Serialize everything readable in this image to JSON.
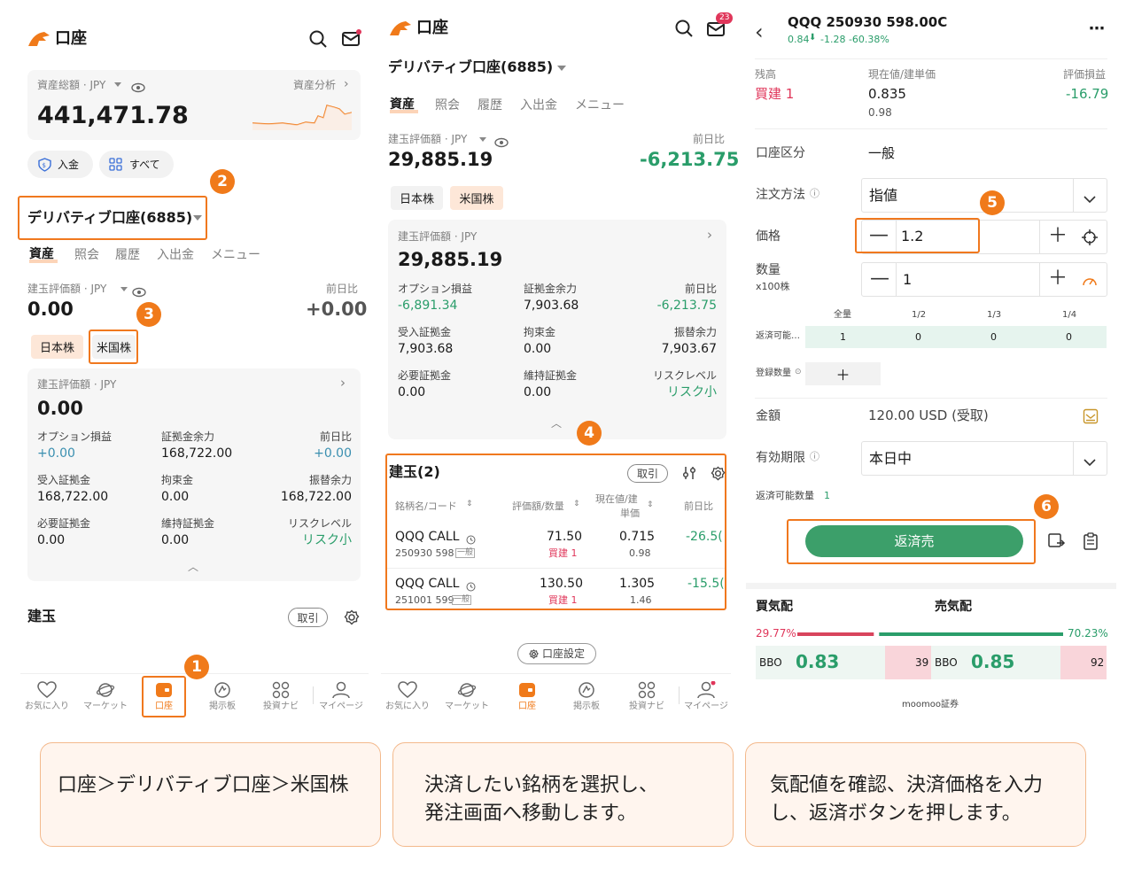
{
  "p1": {
    "title": "口座",
    "asset_label": "資産総額 · JPY",
    "asset_link": "資産分析",
    "asset_value": "441,471.78",
    "deposit": "入金",
    "all": "すべて",
    "account_name": "デリバティブ口座(6885)",
    "tabs": [
      "資産",
      "照会",
      "履歴",
      "入出金",
      "メニュー"
    ],
    "pos_label": "建玉評価額 · JPY",
    "prev_label": "前日比",
    "pos_value": "0.00",
    "prev_value": "+0.00",
    "chip_jp": "日本株",
    "chip_us": "米国株",
    "card_label": "建玉評価額 · JPY",
    "card_value": "0.00",
    "grid": [
      {
        "l": "オプション損益",
        "v": "+0.00"
      },
      {
        "l": "証拠金余力",
        "v": "168,722.00"
      },
      {
        "l": "前日比",
        "v": "+0.00"
      },
      {
        "l": "受入証拠金",
        "v": "168,722.00"
      },
      {
        "l": "拘束金",
        "v": "0.00"
      },
      {
        "l": "振替余力",
        "v": "168,722.00"
      },
      {
        "l": "必要証拠金",
        "v": "0.00"
      },
      {
        "l": "維持証拠金",
        "v": "0.00"
      },
      {
        "l": "リスクレベル",
        "v": "リスク小"
      }
    ],
    "section": "建玉",
    "pill": "取引",
    "nav": [
      "お気に入り",
      "マーケット",
      "口座",
      "掲示板",
      "投資ナビ",
      "マイページ"
    ]
  },
  "p2": {
    "title": "口座",
    "mail_count": "23",
    "account_name": "デリバティブ口座(6885)",
    "tabs": [
      "資産",
      "照会",
      "履歴",
      "入出金",
      "メニュー"
    ],
    "pos_label": "建玉評価額 · JPY",
    "prev_label": "前日比",
    "pos_value": "29,885.19",
    "prev_value": "-6,213.75",
    "chip_jp": "日本株",
    "chip_us": "米国株",
    "card_label": "建玉評価額 · JPY",
    "card_value": "29,885.19",
    "grid": [
      {
        "l": "オプション損益",
        "v": "-6,891.34"
      },
      {
        "l": "証拠金余力",
        "v": "7,903.68"
      },
      {
        "l": "前日比",
        "v": "-6,213.75"
      },
      {
        "l": "受入証拠金",
        "v": "7,903.68"
      },
      {
        "l": "拘束金",
        "v": "0.00"
      },
      {
        "l": "振替余力",
        "v": "7,903.67"
      },
      {
        "l": "必要証拠金",
        "v": "0.00"
      },
      {
        "l": "維持証拠金",
        "v": "0.00"
      },
      {
        "l": "リスクレベル",
        "v": "リスク小"
      }
    ],
    "section": "建玉(2)",
    "pill": "取引",
    "cols": [
      "銘柄名/コード",
      "評価額/数量",
      "現在値/建",
      "単価",
      "前日比"
    ],
    "rows": [
      {
        "name": "QQQ CALL",
        "code": "250930 598",
        "tag": "一般",
        "val": "71.50",
        "qty": "買建 1",
        "cur": "0.715",
        "unit": "0.98",
        "chg": "-26.5("
      },
      {
        "name": "QQQ CALL",
        "code": "251001 599",
        "tag": "一般",
        "val": "130.50",
        "qty": "買建 1",
        "cur": "1.305",
        "unit": "1.46",
        "chg": "-15.5("
      }
    ],
    "settings": "口座設定",
    "nav": [
      "お気に入り",
      "マーケット",
      "口座",
      "掲示板",
      "投資ナビ",
      "マイページ"
    ]
  },
  "p3": {
    "title": "QQQ 250930 598.00C",
    "subtitle": "0.84",
    "sub_change": "-1.28 -60.38%",
    "hdr": [
      "残高",
      "現在値/建単価",
      "評価損益"
    ],
    "bal": "買建 1",
    "cur": "0.835",
    "unit": "0.98",
    "pl": "-16.79",
    "acct_l": "口座区分",
    "acct_v": "一般",
    "method_l": "注文方法",
    "method_v": "指値",
    "price_l": "価格",
    "price_v": "1.2",
    "qty_l": "数量",
    "qty_sub": "x100株",
    "qty_v": "1",
    "ratios": [
      "全量",
      "1/2",
      "1/3",
      "1/4"
    ],
    "ret_l": "返済可能…",
    "ret_vals": [
      "1",
      "0",
      "0",
      "0"
    ],
    "reg_l": "登録数量",
    "amt_l": "金額",
    "amt_v": "120.00 USD (受取)",
    "exp_l": "有効期限",
    "exp_v": "本日中",
    "retq_l": "返済可能数量",
    "retq_v": "1",
    "btn": "返済売",
    "buy_l": "買気配",
    "sell_l": "売気配",
    "buy_pct": "29.77%",
    "sell_pct": "70.23%",
    "buy_ratio": 0.2977,
    "bbo": "BBO",
    "bid": "0.83",
    "bid_sz": "39",
    "ask": "0.85",
    "ask_sz": "92",
    "footer": "moomoo証券"
  },
  "badges": [
    "1",
    "2",
    "3",
    "4",
    "5",
    "6"
  ],
  "captions": {
    "c1": "口座＞デリバティブ口座＞米国株",
    "c2a": "決済したい銘柄を選択し、",
    "c2b": "発注画面へ移動します。",
    "c3a": "気配値を確認、決済価格を入力",
    "c3b": "し、返済ボタンを押します。"
  },
  "colors": {
    "accent": "#f07a1a",
    "green": "#2a9d6a",
    "red": "#e0365a"
  }
}
